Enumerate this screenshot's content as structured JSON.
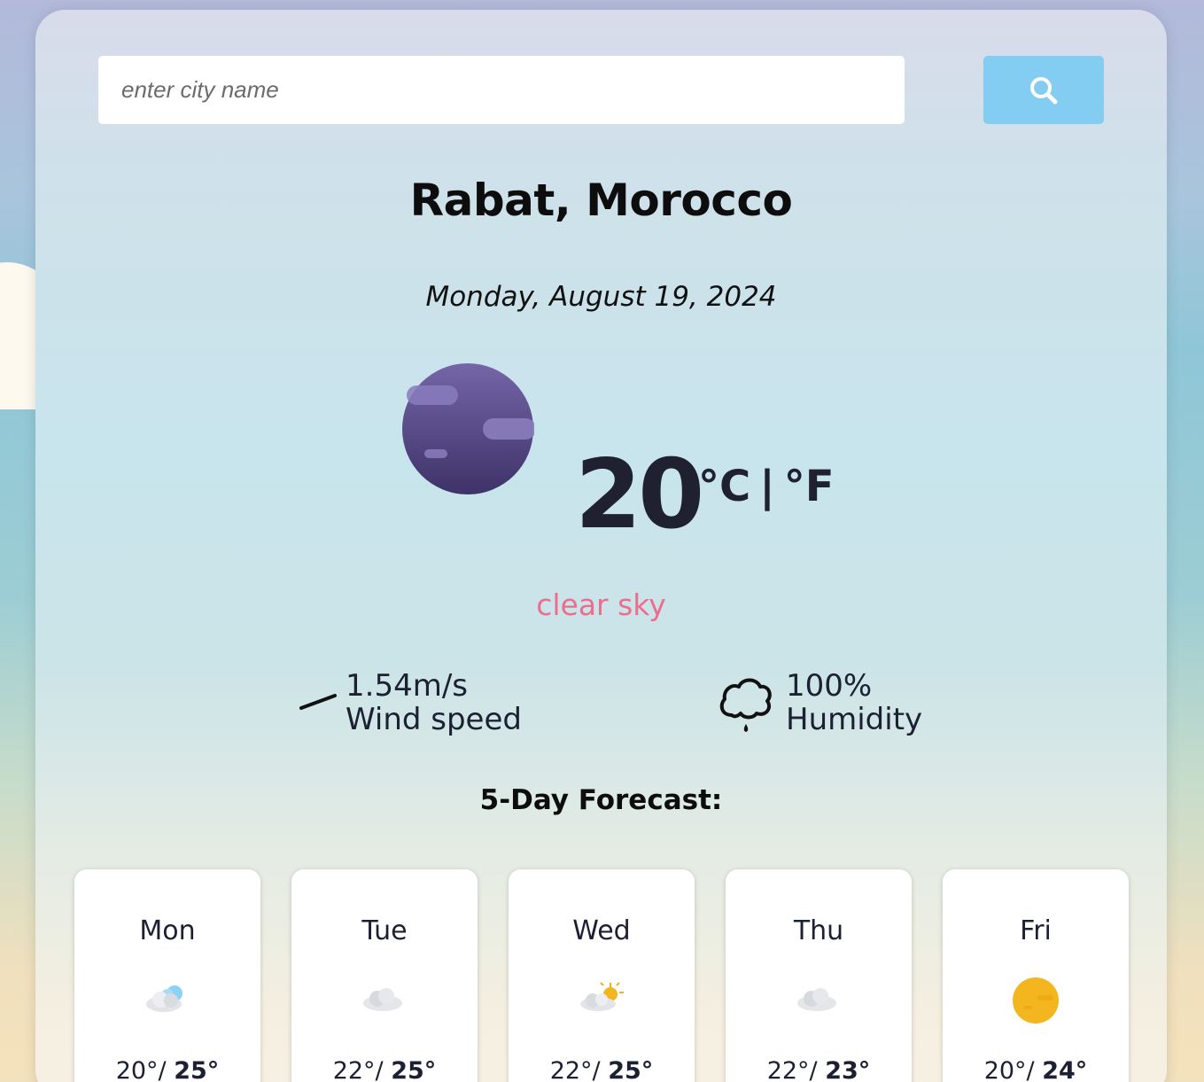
{
  "search": {
    "placeholder": "enter city name",
    "button_icon": "search-icon"
  },
  "location": {
    "city": "Rabat, Morocco",
    "date": "Monday, August 19, 2024"
  },
  "current": {
    "icon": "clear-night-moon-icon",
    "temperature": "20",
    "unit_celsius": "°C",
    "unit_separator": "|",
    "unit_fahrenheit": "°F",
    "description": "clear sky"
  },
  "stats": {
    "wind": {
      "value": "1.54m/s",
      "label": "Wind speed",
      "icon": "wind-icon"
    },
    "humidity": {
      "value": "100%",
      "label": "Humidity",
      "icon": "humidity-icon"
    }
  },
  "forecast": {
    "title": "5-Day Forecast:",
    "days": [
      {
        "day": "Mon",
        "icon": "cloud-rain-icon",
        "min": "20°/",
        "max": "25°"
      },
      {
        "day": "Tue",
        "icon": "cloud-icon",
        "min": "22°/",
        "max": "25°"
      },
      {
        "day": "Wed",
        "icon": "partly-cloudy-icon",
        "min": "22°/",
        "max": "25°"
      },
      {
        "day": "Thu",
        "icon": "cloud-icon",
        "min": "22°/",
        "max": "23°"
      },
      {
        "day": "Fri",
        "icon": "sun-icon",
        "min": "20°/",
        "max": "24°"
      }
    ]
  },
  "colors": {
    "search_button": "#84cdf2",
    "description": "#ee6d8d",
    "text_dark": "#1c2033",
    "moon": "#5a4a95",
    "sun": "#f3b61f"
  }
}
